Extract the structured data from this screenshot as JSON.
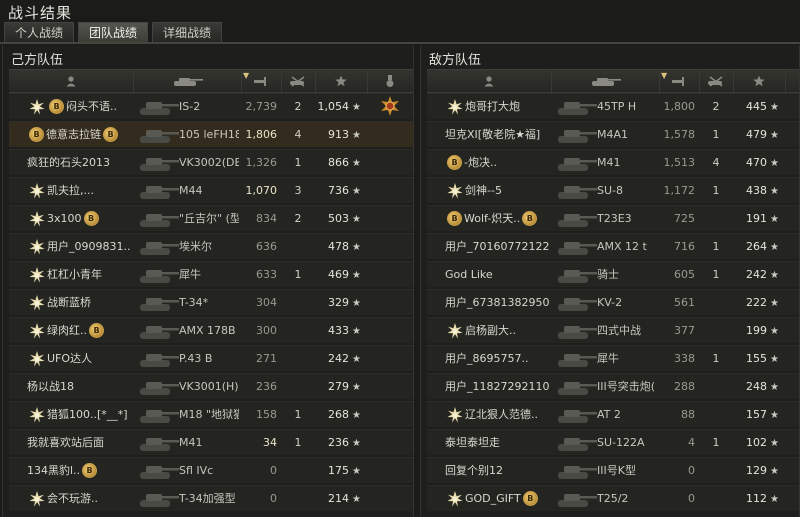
{
  "window_title": "战斗结果",
  "tabs": [
    {
      "label": "个人战绩",
      "active": false
    },
    {
      "label": "团队战绩",
      "active": true
    },
    {
      "label": "详细战绩",
      "active": false
    }
  ],
  "colors": {
    "accent": "#d9c27a",
    "background": "#1b1b19",
    "highlight_row": "#332b1d"
  },
  "left_team": {
    "title": "己方队伍",
    "players": [
      {
        "name": "闷头不语..",
        "medal": true,
        "clan": true,
        "tank": "IS-2",
        "damage": "2,739",
        "damage_hi": false,
        "kills": "2",
        "xp": "1,054",
        "badge": true,
        "me": false
      },
      {
        "name": "德意志拉链",
        "medal": false,
        "clan": true,
        "clan_after": true,
        "tank": "105 leFH18B",
        "damage": "1,806",
        "damage_hi": true,
        "kills": "4",
        "xp": "913",
        "badge": false,
        "me": true
      },
      {
        "name": "疯狂的石头2013",
        "medal": false,
        "clan": false,
        "tank": "VK3002(DB)",
        "damage": "1,326",
        "damage_hi": false,
        "kills": "1",
        "xp": "866",
        "badge": false,
        "me": false
      },
      {
        "name": "凯夫拉,...",
        "medal": true,
        "clan": false,
        "tank": "M44",
        "damage": "1,070",
        "damage_hi": true,
        "kills": "3",
        "xp": "736",
        "badge": false,
        "me": false
      },
      {
        "name": "3x100",
        "medal": true,
        "clan": false,
        "clan_after": true,
        "tank": "\"丘吉尔\" (型",
        "damage": "834",
        "damage_hi": false,
        "kills": "2",
        "xp": "503",
        "badge": false,
        "me": false
      },
      {
        "name": "用户_0909831..",
        "medal": true,
        "clan": false,
        "tank": "埃米尔",
        "damage": "636",
        "damage_hi": false,
        "kills": "",
        "xp": "478",
        "badge": false,
        "me": false
      },
      {
        "name": "杠杠小青年",
        "medal": true,
        "clan": false,
        "tank": "犀牛",
        "damage": "633",
        "damage_hi": false,
        "kills": "1",
        "xp": "469",
        "badge": false,
        "me": false
      },
      {
        "name": "战断蓝桥",
        "medal": true,
        "clan": false,
        "tank": "T-34*",
        "damage": "304",
        "damage_hi": false,
        "kills": "",
        "xp": "329",
        "badge": false,
        "me": false
      },
      {
        "name": "绿肉红..",
        "medal": true,
        "clan": false,
        "clan_after": true,
        "tank": "AMX 178B",
        "damage": "300",
        "damage_hi": false,
        "kills": "",
        "xp": "433",
        "badge": false,
        "me": false
      },
      {
        "name": "UFO达人",
        "medal": true,
        "clan": false,
        "tank": "P.43 B",
        "damage": "271",
        "damage_hi": false,
        "kills": "",
        "xp": "242",
        "badge": false,
        "me": false
      },
      {
        "name": "杨以战18",
        "medal": false,
        "clan": false,
        "tank": "VK3001(H)",
        "damage": "236",
        "damage_hi": false,
        "kills": "",
        "xp": "279",
        "badge": false,
        "me": false
      },
      {
        "name": "猎狐100..[*__*]",
        "medal": true,
        "clan": false,
        "tank": "M18 \"地狱猫",
        "damage": "158",
        "damage_hi": false,
        "kills": "1",
        "xp": "268",
        "badge": false,
        "me": false
      },
      {
        "name": "我就喜欢站后面",
        "medal": false,
        "clan": false,
        "tank": "M41",
        "damage": "34",
        "damage_hi": true,
        "kills": "1",
        "xp": "236",
        "badge": false,
        "me": false
      },
      {
        "name": "134黑豹l..",
        "medal": false,
        "clan": false,
        "clan_after": true,
        "tank": "Sfl IVc",
        "damage": "0",
        "damage_hi": false,
        "kills": "",
        "xp": "175",
        "badge": false,
        "me": false
      },
      {
        "name": "会不玩游..",
        "medal": true,
        "clan": false,
        "tank": "T-34加强型",
        "damage": "0",
        "damage_hi": false,
        "kills": "",
        "xp": "214",
        "badge": false,
        "me": false
      }
    ]
  },
  "right_team": {
    "title": "敌方队伍",
    "players": [
      {
        "name": "炮哥打大炮",
        "medal": true,
        "clan": false,
        "tank": "45TP H",
        "damage": "1,800",
        "kills": "2",
        "xp": "445"
      },
      {
        "name": "坦克XI[敬老院★福]",
        "medal": false,
        "clan": false,
        "tank": "M4A1",
        "damage": "1,578",
        "kills": "1",
        "xp": "479"
      },
      {
        "name": "-炮决..",
        "medal": false,
        "clan": true,
        "tank": "M41",
        "damage": "1,513",
        "kills": "4",
        "xp": "470"
      },
      {
        "name": "剑神--5",
        "medal": true,
        "clan": false,
        "tank": "SU-8",
        "damage": "1,172",
        "kills": "1",
        "xp": "438"
      },
      {
        "name": "Wolf-炽天..",
        "medal": false,
        "clan": true,
        "clan_after": true,
        "tank": "T23E3",
        "damage": "725",
        "kills": "",
        "xp": "191"
      },
      {
        "name": "用户_70160772122",
        "medal": false,
        "clan": false,
        "tank": "AMX 12 t",
        "damage": "716",
        "kills": "1",
        "xp": "264"
      },
      {
        "name": "God Like",
        "medal": false,
        "clan": false,
        "tank": "骑士",
        "damage": "605",
        "kills": "1",
        "xp": "242"
      },
      {
        "name": "用户_67381382950",
        "medal": false,
        "clan": false,
        "tank": "KV-2",
        "damage": "561",
        "kills": "",
        "xp": "222"
      },
      {
        "name": "启杨副大..",
        "medal": true,
        "clan": false,
        "tank": "四式中战",
        "damage": "377",
        "kills": "",
        "xp": "199"
      },
      {
        "name": "用户_8695757..",
        "medal": false,
        "clan": false,
        "tank": "犀牛",
        "damage": "338",
        "kills": "1",
        "xp": "155"
      },
      {
        "name": "用户_11827292110",
        "medal": false,
        "clan": false,
        "tank": "III号突击炮(",
        "damage": "288",
        "kills": "",
        "xp": "248"
      },
      {
        "name": "辽北狠人范德..",
        "medal": true,
        "clan": false,
        "tank": "AT 2",
        "damage": "88",
        "kills": "",
        "xp": "157"
      },
      {
        "name": "泰坦泰坦走",
        "medal": false,
        "clan": false,
        "tank": "SU-122A",
        "damage": "4",
        "kills": "1",
        "xp": "102"
      },
      {
        "name": "回复个别12",
        "medal": false,
        "clan": false,
        "tank": "III号K型",
        "damage": "0",
        "kills": "",
        "xp": "129"
      },
      {
        "name": "GOD_GIFT",
        "medal": true,
        "clan": false,
        "clan_after": true,
        "tank": "T25/2",
        "damage": "0",
        "kills": "",
        "xp": "112"
      }
    ]
  },
  "icons": {
    "player": "person-icon",
    "tank": "tank-icon",
    "damage": "cannon-shot-icon",
    "kills": "destroyed-tank-icon",
    "xp": "star-icon",
    "badge": "medal-icon",
    "clan": "clan-badge-icon"
  },
  "star_glyph": "★",
  "clan_glyph": "B",
  "sort_glyph": "▼"
}
